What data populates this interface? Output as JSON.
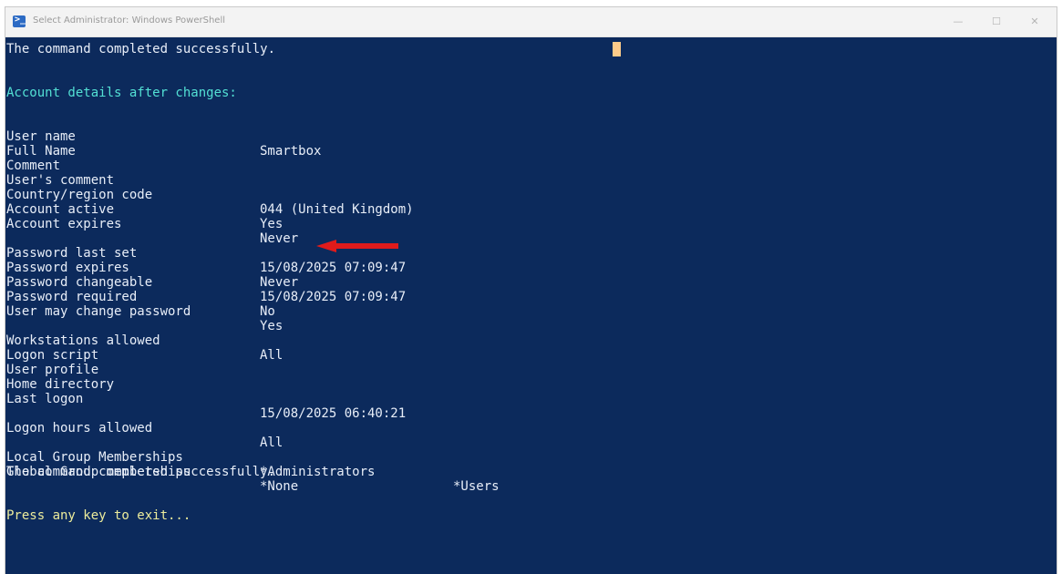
{
  "window": {
    "title": "Select Administrator: Windows PowerShell",
    "minimize_label": "—",
    "maximize_label": "☐",
    "close_label": "✕",
    "icon": "powershell-icon"
  },
  "console": {
    "first_line": "The command completed successfully.",
    "header": "Account details after changes:",
    "rows": [
      {
        "label": "User name",
        "value": "Smartbox"
      },
      {
        "label": "Full Name",
        "value": ""
      },
      {
        "label": "Comment",
        "value": ""
      },
      {
        "label": "User's comment",
        "value": ""
      },
      {
        "label": "Country/region code",
        "value": "044 (United Kingdom)"
      },
      {
        "label": "Account active",
        "value": "Yes"
      },
      {
        "label": "Account expires",
        "value": "Never"
      },
      {
        "label": "Password last set",
        "value": "15/08/2025 07:09:47"
      },
      {
        "label": "Password expires",
        "value": "Never"
      },
      {
        "label": "Password changeable",
        "value": "15/08/2025 07:09:47"
      },
      {
        "label": "Password required",
        "value": "No"
      },
      {
        "label": "User may change password",
        "value": "Yes"
      },
      {
        "label": "Workstations allowed",
        "value": "All"
      },
      {
        "label": "Logon script",
        "value": ""
      },
      {
        "label": "User profile",
        "value": ""
      },
      {
        "label": "Home directory",
        "value": ""
      },
      {
        "label": "Last logon",
        "value": "15/08/2025 06:40:21"
      },
      {
        "label": "Logon hours allowed",
        "value": "All"
      },
      {
        "label": "Local Group Memberships",
        "value": "*Administrators",
        "value2": "*Users"
      },
      {
        "label": "Global Group memberships",
        "value": "*None"
      }
    ],
    "last_line": "The command completed successfully.",
    "prompt": "Press any key to exit..."
  },
  "colors": {
    "background": "#0c2a5c",
    "text": "#e8eef8",
    "header": "#53e0d4",
    "prompt": "#ecec9c",
    "arrow": "#e01b1b",
    "cursor": "#ffcc8a"
  }
}
